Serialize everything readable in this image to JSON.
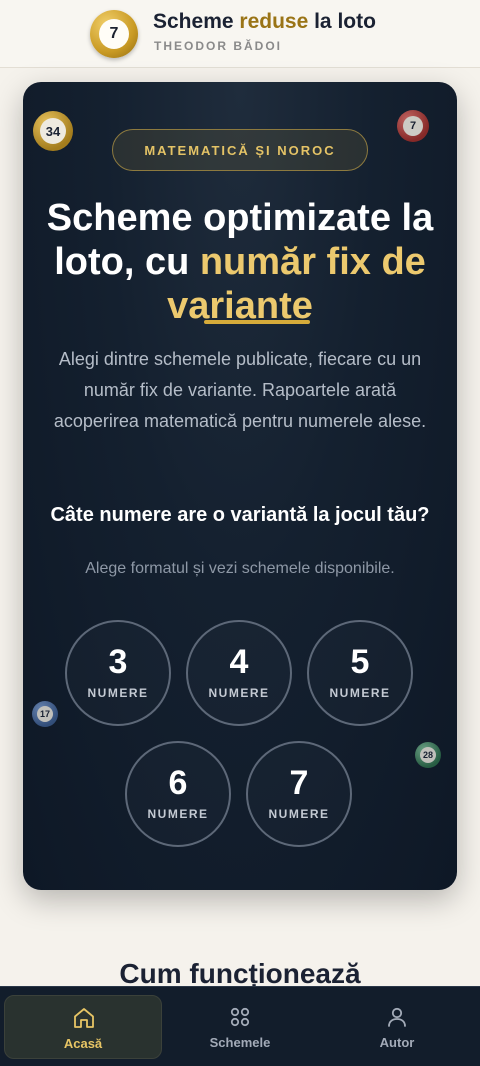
{
  "header": {
    "logo_number": "7",
    "title_before": "Scheme ",
    "title_accent": "reduse",
    "title_after": " la loto",
    "author": "THEODOR BĂDOI"
  },
  "hero": {
    "badge": "MATEMATICĂ ȘI NOROC",
    "title_line1": "Scheme optimizate la",
    "title_line2_white": "loto, cu ",
    "title_line2_gold": "număr fix de",
    "title_line3_gold": "variante",
    "description": "Alegi dintre schemele publicate, fiecare cu un număr fix de variante. Rapoartele arată acoperirea matematică pentru numerele alese.",
    "question": "Câte numere are o variantă la jocul tău?",
    "question_sub": "Alege formatul și vezi schemele disponibile.",
    "decor_balls": [
      "34",
      "7",
      "17",
      "28"
    ],
    "options": [
      {
        "number": "3",
        "label": "NUMERE"
      },
      {
        "number": "4",
        "label": "NUMERE"
      },
      {
        "number": "5",
        "label": "NUMERE"
      },
      {
        "number": "6",
        "label": "NUMERE"
      },
      {
        "number": "7",
        "label": "NUMERE"
      }
    ]
  },
  "section": {
    "heading": "Cum funcționează"
  },
  "bottom_nav": {
    "items": [
      {
        "label": "Acasă",
        "icon": "home-icon",
        "active": true
      },
      {
        "label": "Schemele",
        "icon": "grid-icon",
        "active": false
      },
      {
        "label": "Autor",
        "icon": "user-icon",
        "active": false
      }
    ]
  },
  "colors": {
    "accent_gold": "#ecc96e",
    "card_bg": "#14202f",
    "page_bg": "#f5f2ec"
  }
}
